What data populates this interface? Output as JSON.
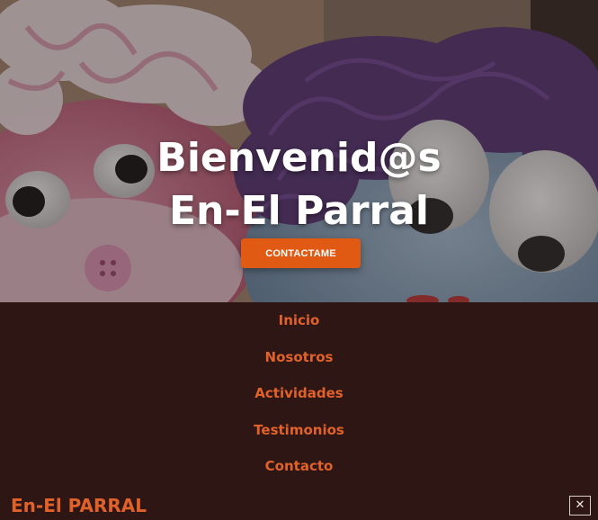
{
  "hero": {
    "title_line1": "Bienvenid@s",
    "title_line2": "En-El Parral",
    "cta_label": "CONTACTAME"
  },
  "nav": {
    "items": [
      {
        "label": "Inicio"
      },
      {
        "label": "Nosotros"
      },
      {
        "label": "Actividades"
      },
      {
        "label": "Testimonios"
      },
      {
        "label": "Contacto"
      }
    ]
  },
  "footer": {
    "brand": "En-El PARRAL",
    "close_icon": "close-icon",
    "close_glyph": "✕"
  },
  "colors": {
    "accent": "#e0622a",
    "button": "#e05a14",
    "menu_bg": "#2e1614",
    "text_light": "#ffffff"
  }
}
